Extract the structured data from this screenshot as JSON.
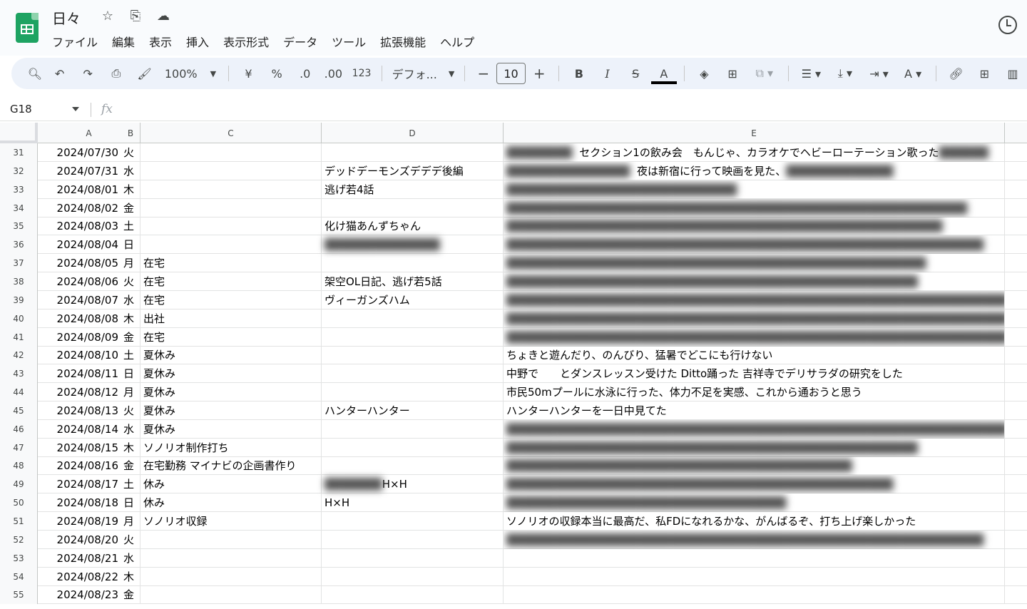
{
  "app": {
    "title": "日々",
    "icons": [
      "star-icon",
      "move-to-drive-icon",
      "cloud-status-icon",
      "history-icon"
    ]
  },
  "menu": [
    "ファイル",
    "編集",
    "表示",
    "挿入",
    "表示形式",
    "データ",
    "ツール",
    "拡張機能",
    "ヘルプ"
  ],
  "toolbar": {
    "zoom": "100%",
    "currency": "¥",
    "percent": "%",
    "dec_decrease": ".0",
    "dec_increase": ".00",
    "number_format": "123",
    "font": "デフォ...",
    "font_size": "10",
    "bold": "B",
    "italic": "I",
    "strike": "S",
    "text_color": "A"
  },
  "formula_bar": {
    "name_box": "G18",
    "fx": "fx"
  },
  "columns": [
    "A",
    "B",
    "C",
    "D",
    "E"
  ],
  "rows": [
    {
      "n": "31",
      "a": "2024/07/30",
      "b": "火",
      "c": "",
      "d": "",
      "e_blur": "████████",
      "e": "セクション1の飲み会　もんじゃ、カラオケでヘビーローテーション歌った",
      "e_blur2": "██████"
    },
    {
      "n": "32",
      "a": "2024/07/31",
      "b": "水",
      "c": "",
      "d": "デッドデーモンズデデデ後編",
      "e_blur": "███████████████",
      "e": "夜は新宿に行って映画を見た、",
      "e_blur2": "█████████████"
    },
    {
      "n": "33",
      "a": "2024/08/01",
      "b": "木",
      "c": "",
      "d": "逃げ若4話",
      "e_blur": "████████████████████████████",
      "e": "",
      "e_blur2": ""
    },
    {
      "n": "34",
      "a": "2024/08/02",
      "b": "金",
      "c": "",
      "d": "",
      "e_blur": "████████████████████████████████████████████████████████",
      "e": "",
      "e_blur2": ""
    },
    {
      "n": "35",
      "a": "2024/08/03",
      "b": "土",
      "c": "",
      "d": "化け猫あんずちゃん",
      "e_blur": "█████████████████████████████████████████████████████",
      "e": "",
      "e_blur2": ""
    },
    {
      "n": "36",
      "a": "2024/08/04",
      "b": "日",
      "c": "",
      "d_blur": "██████████████",
      "e_blur": "██████████████████████████████████████████████████████████",
      "e": "",
      "e_blur2": ""
    },
    {
      "n": "37",
      "a": "2024/08/05",
      "b": "月",
      "c": "在宅",
      "d": "",
      "e_blur": "███████████████████████████████████████████████████",
      "e": "",
      "e_blur2": ""
    },
    {
      "n": "38",
      "a": "2024/08/06",
      "b": "火",
      "c": "在宅",
      "d": "架空OL日記、逃げ若5話",
      "e_blur": "██████████████████████████████████████████████████",
      "e": "",
      "e_blur2": ""
    },
    {
      "n": "39",
      "a": "2024/08/07",
      "b": "水",
      "c": "在宅",
      "d": "ヴィーガンズハム",
      "e_blur": "█████████████████████████████████████████████████████████████",
      "e": "",
      "e_blur2": ""
    },
    {
      "n": "40",
      "a": "2024/08/08",
      "b": "木",
      "c": "出社",
      "d": "",
      "e_blur": "█████████████████████████████████████████████████████████████",
      "e": "",
      "e_blur2": ""
    },
    {
      "n": "41",
      "a": "2024/08/09",
      "b": "金",
      "c": "在宅",
      "d": "",
      "e_blur": "█████████████████████████████████████████████████████████████",
      "e": "",
      "e_blur2": ""
    },
    {
      "n": "42",
      "a": "2024/08/10",
      "b": "土",
      "c": "夏休み",
      "d": "",
      "e": "ちょきと遊んだり、のんびり、猛暑でどこにも行けない"
    },
    {
      "n": "43",
      "a": "2024/08/11",
      "b": "日",
      "c": "夏休み",
      "d": "",
      "e": "中野で　　とダンスレッスン受けた Ditto踊った 吉祥寺でデリサラダの研究をした"
    },
    {
      "n": "44",
      "a": "2024/08/12",
      "b": "月",
      "c": "夏休み",
      "d": "",
      "e": "市民50mプールに水泳に行った、体力不足を実感、これから通おうと思う"
    },
    {
      "n": "45",
      "a": "2024/08/13",
      "b": "火",
      "c": "夏休み",
      "d": "ハンターハンター",
      "e": "ハンターハンターを一日中見てた"
    },
    {
      "n": "46",
      "a": "2024/08/14",
      "b": "水",
      "c": "夏休み",
      "d": "",
      "e_blur": "█████████████████████████████████████████████████████████████",
      "e": "",
      "e_blur2": ""
    },
    {
      "n": "47",
      "a": "2024/08/15",
      "b": "木",
      "c": "ソノリオ制作打ち",
      "d": "",
      "e_blur": "██████████████████████████████████████████████████",
      "e": "",
      "e_blur2": ""
    },
    {
      "n": "48",
      "a": "2024/08/16",
      "b": "金",
      "c": "在宅勤務 マイナビの企画書作り",
      "d": "",
      "e_blur": "██████████████████████████████████████████",
      "e": "",
      "e_blur2": ""
    },
    {
      "n": "49",
      "a": "2024/08/17",
      "b": "土",
      "c": "休み",
      "d_blur": "███████",
      "d": "H×H",
      "e_blur": "███████████████████████████████████████████████",
      "e": "",
      "e_blur2": ""
    },
    {
      "n": "50",
      "a": "2024/08/18",
      "b": "日",
      "c": "休み",
      "d": "H×H",
      "e_blur": "██████████████████████████████████",
      "e": "",
      "e_blur2": ""
    },
    {
      "n": "51",
      "a": "2024/08/19",
      "b": "月",
      "c": "ソノリオ収録",
      "d": "",
      "e": "ソノリオの収録本当に最高だ、私FDになれるかな、がんばるぞ、打ち上げ楽しかった"
    },
    {
      "n": "52",
      "a": "2024/08/20",
      "b": "火",
      "c": "",
      "d": "",
      "e_blur": "██████████████████████████████████████████████████████████",
      "e": "",
      "e_blur2": ""
    },
    {
      "n": "53",
      "a": "2024/08/21",
      "b": "水",
      "c": "",
      "d": "",
      "e": ""
    },
    {
      "n": "54",
      "a": "2024/08/22",
      "b": "木",
      "c": "",
      "d": "",
      "e": ""
    },
    {
      "n": "55",
      "a": "2024/08/23",
      "b": "金",
      "c": "",
      "d": "",
      "e": ""
    }
  ]
}
